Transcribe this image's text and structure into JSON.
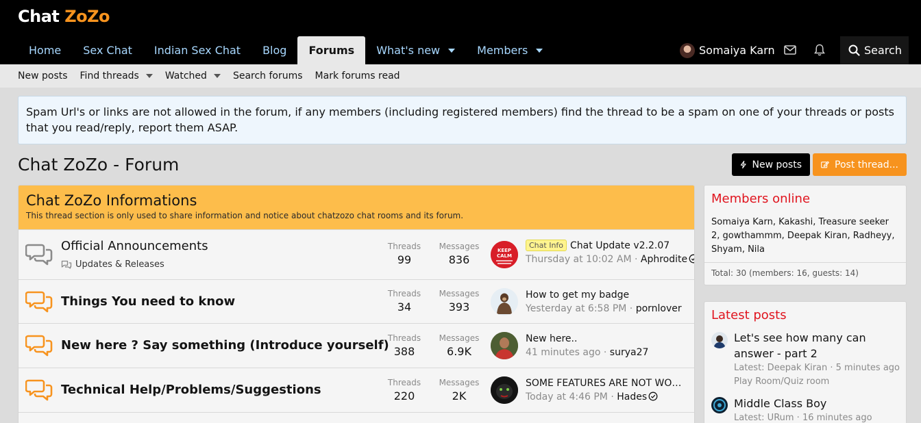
{
  "header": {
    "logo_main": "Chat ",
    "logo_accent": "ZoZo",
    "nav": [
      {
        "label": "Home"
      },
      {
        "label": "Sex Chat"
      },
      {
        "label": "Indian Sex Chat"
      },
      {
        "label": "Blog"
      },
      {
        "label": "Forums",
        "active": true
      },
      {
        "label": "What's new",
        "dropdown": true
      },
      {
        "label": "Members",
        "dropdown": true
      }
    ],
    "user_name": "Somaiya Karn",
    "search_label": "Search",
    "icons": [
      "envelope-icon",
      "bell-icon",
      "search-icon"
    ]
  },
  "subnav": [
    {
      "label": "New posts"
    },
    {
      "label": "Find threads",
      "dropdown": true
    },
    {
      "label": "Watched",
      "dropdown": true
    },
    {
      "label": "Search forums"
    },
    {
      "label": "Mark forums read"
    }
  ],
  "notice": "Spam Url's or links are not allowed in the forum, if any members (including registered members) find the thread to be a spam on one of your threads or posts that you read/reply, report them ASAP.",
  "page_title": "Chat ZoZo - Forum",
  "buttons": {
    "new_posts": "New posts",
    "post_thread": "Post thread..."
  },
  "category": {
    "title": "Chat ZoZo Informations",
    "description": "This thread section is only used to share information and notice about chatzozo chat rooms and its forum."
  },
  "nodes": [
    {
      "title": "Official Announcements",
      "subforum": "Updates & Releases",
      "threads_label": "Threads",
      "threads": "99",
      "messages_label": "Messages",
      "messages": "836",
      "last_prefix": "Chat Info",
      "last_title": "Chat Update v2.2.07",
      "last_time": "Thursday at 10:02 AM",
      "last_user": "Aphrodite"
    },
    {
      "title": "Things You need to know",
      "threads_label": "Threads",
      "threads": "34",
      "messages_label": "Messages",
      "messages": "393",
      "last_title": "How to get my badge",
      "last_time": "Yesterday at 6:58 PM",
      "last_user": "pornlover"
    },
    {
      "title": "New here ? Say something (Introduce yourself)",
      "threads_label": "Threads",
      "threads": "388",
      "messages_label": "Messages",
      "messages": "6.9K",
      "last_title": "New here..",
      "last_time": "41 minutes ago",
      "last_user": "surya27"
    },
    {
      "title": "Technical Help/Problems/Suggestions",
      "threads_label": "Threads",
      "threads": "220",
      "messages_label": "Messages",
      "messages": "2K",
      "last_title": "SOME FEATURES ARE NOT WORKING",
      "last_time": "Today at 4:46 PM",
      "last_user": "Hades"
    }
  ],
  "members_online": {
    "title": "Members online",
    "names": "Somaiya Karn, Kakashi, Treasure seeker 2, gowthammm, Deepak Kiran, Radheyy, Shyam, Nila",
    "total": "Total: 30 (members: 16, guests: 14)"
  },
  "latest_posts": {
    "title": "Latest posts",
    "items": [
      {
        "title": "Let's see how many can answer - part 2",
        "meta": "Latest: Deepak Kiran · 5 minutes ago",
        "forum": "Play Room/Quiz room"
      },
      {
        "title": "Middle Class Boy",
        "meta": "Latest: URum · 16 minutes ago"
      }
    ]
  },
  "colors": {
    "accent": "#f7931e",
    "nav_link": "#a8d8ff",
    "category_bg": "#fdbd4b",
    "sidebar_title": "#e0141e"
  }
}
